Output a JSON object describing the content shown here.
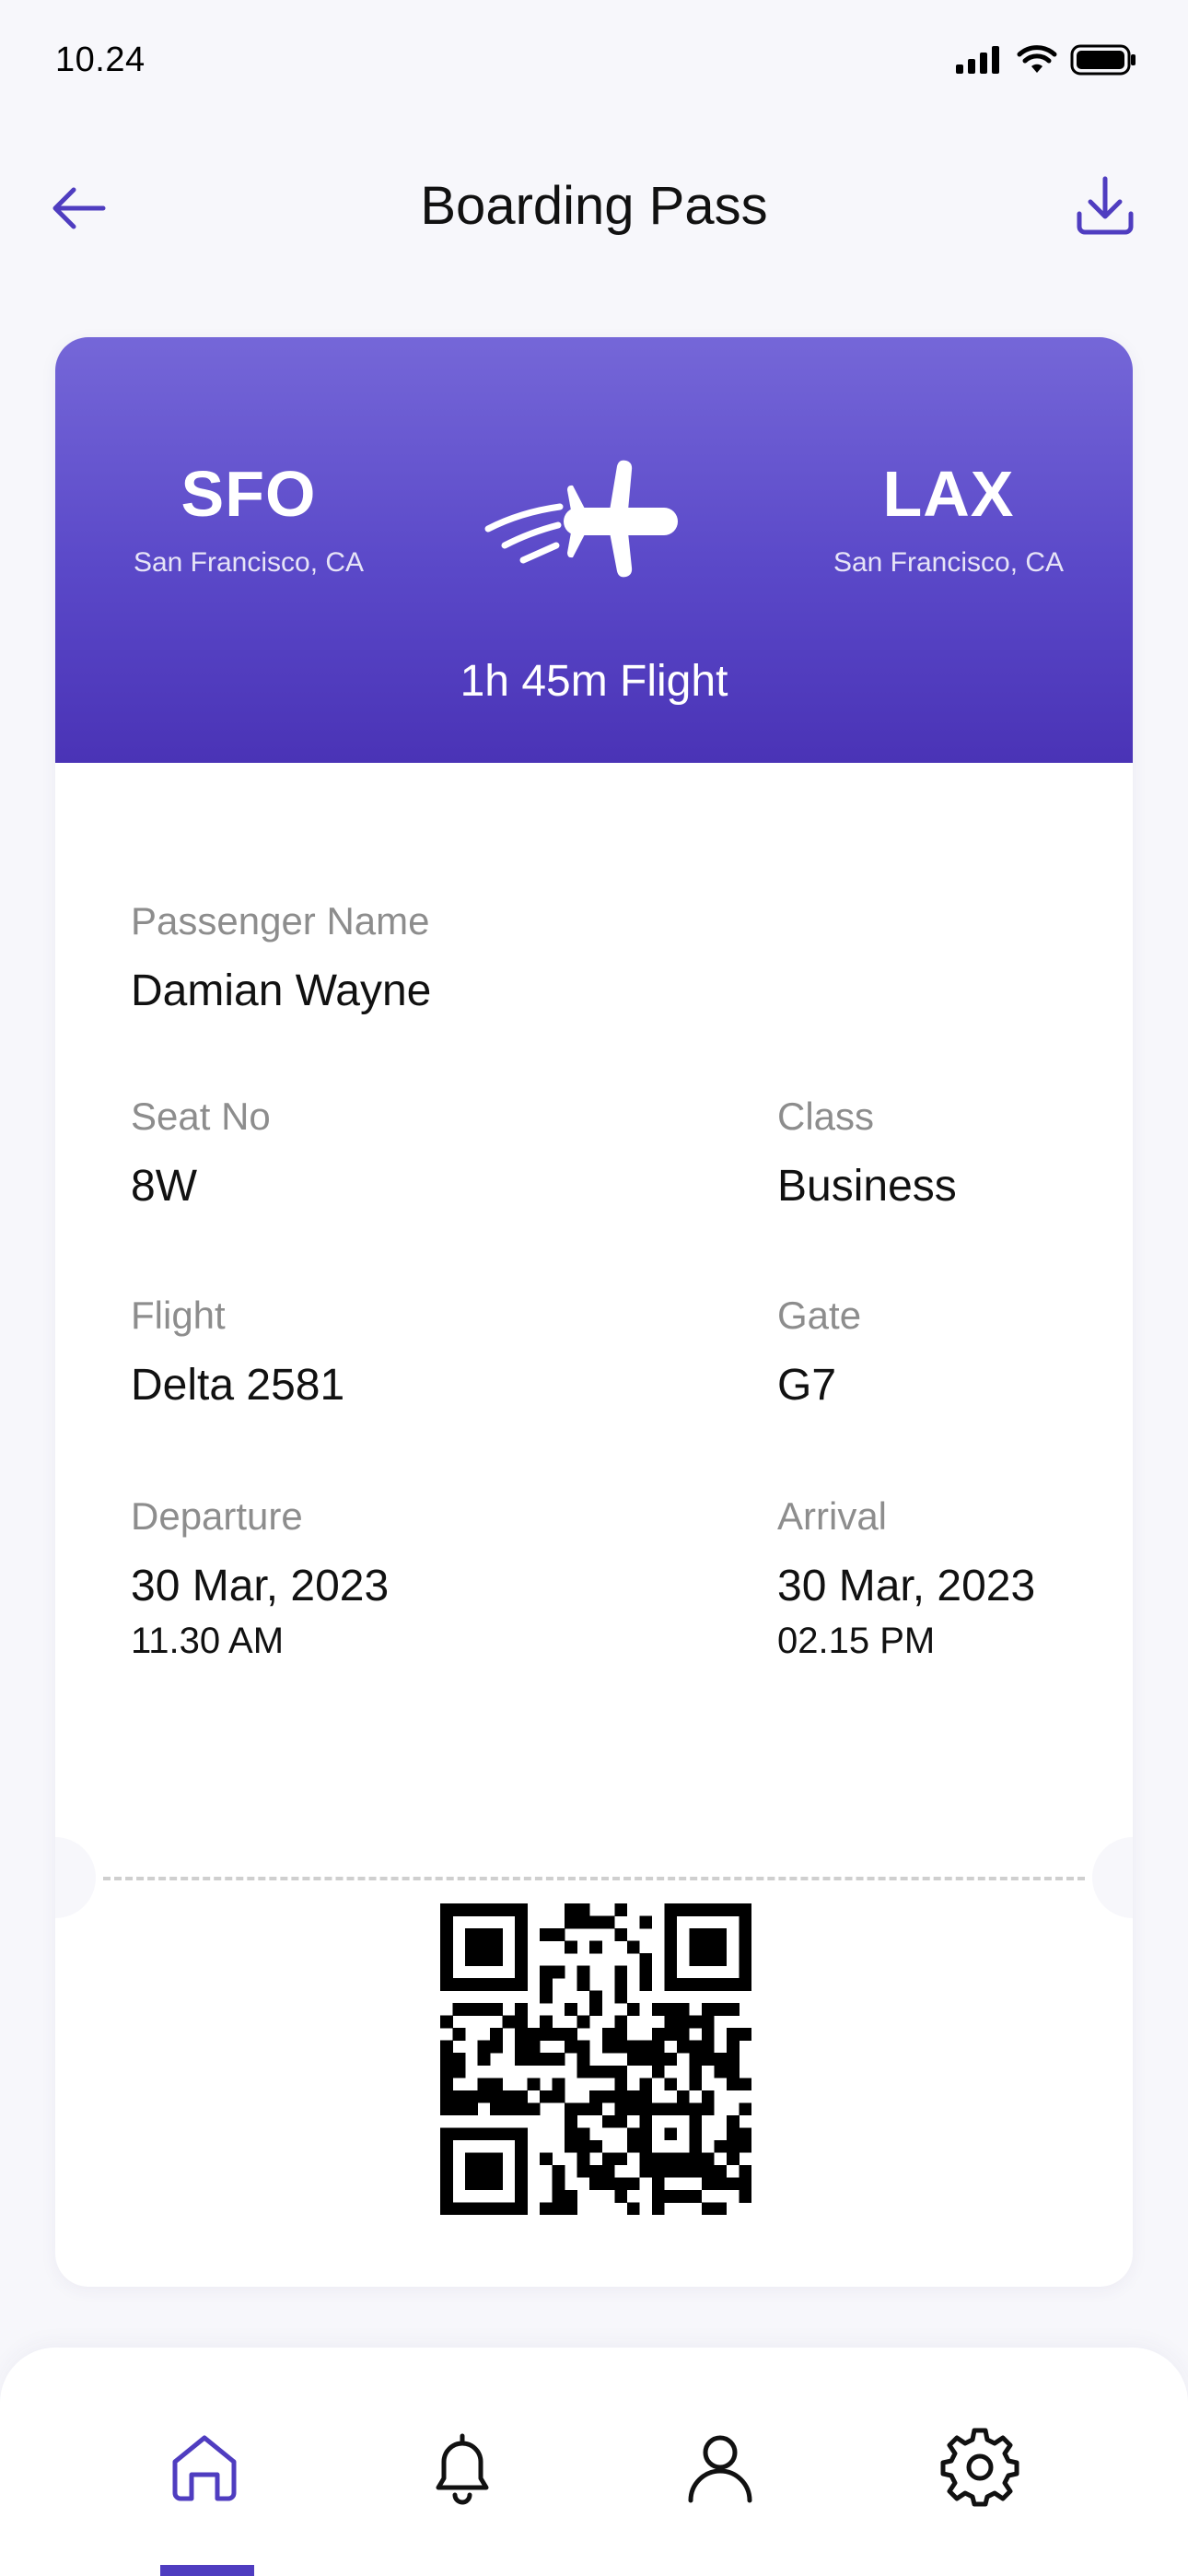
{
  "status_bar": {
    "time": "10.24"
  },
  "header": {
    "title": "Boarding Pass"
  },
  "route": {
    "origin": {
      "code": "SFO",
      "city": "San Francisco, CA"
    },
    "destination": {
      "code": "LAX",
      "city": "San Francisco, CA"
    },
    "duration": "1h 45m Flight"
  },
  "details": {
    "passenger": {
      "label": "Passenger Name",
      "value": "Damian Wayne"
    },
    "seat": {
      "label": "Seat No",
      "value": "8W"
    },
    "class": {
      "label": "Class",
      "value": "Business"
    },
    "flight": {
      "label": "Flight",
      "value": "Delta 2581"
    },
    "gate": {
      "label": "Gate",
      "value": "G7"
    },
    "departure": {
      "label": "Departure",
      "date": "30 Mar, 2023",
      "time": "11.30 AM"
    },
    "arrival": {
      "label": "Arrival",
      "date": "30 Mar, 2023",
      "time": "02.15 PM"
    }
  },
  "nav": {
    "items": [
      "home-icon",
      "bell-icon",
      "user-icon",
      "gear-icon"
    ],
    "active": "home"
  },
  "colors": {
    "accent": "#4f3dc0",
    "gradient_top": "#7567d8",
    "gradient_bottom": "#4a33b6",
    "background": "#f7f7fb",
    "label_gray": "#8d8d8d"
  }
}
